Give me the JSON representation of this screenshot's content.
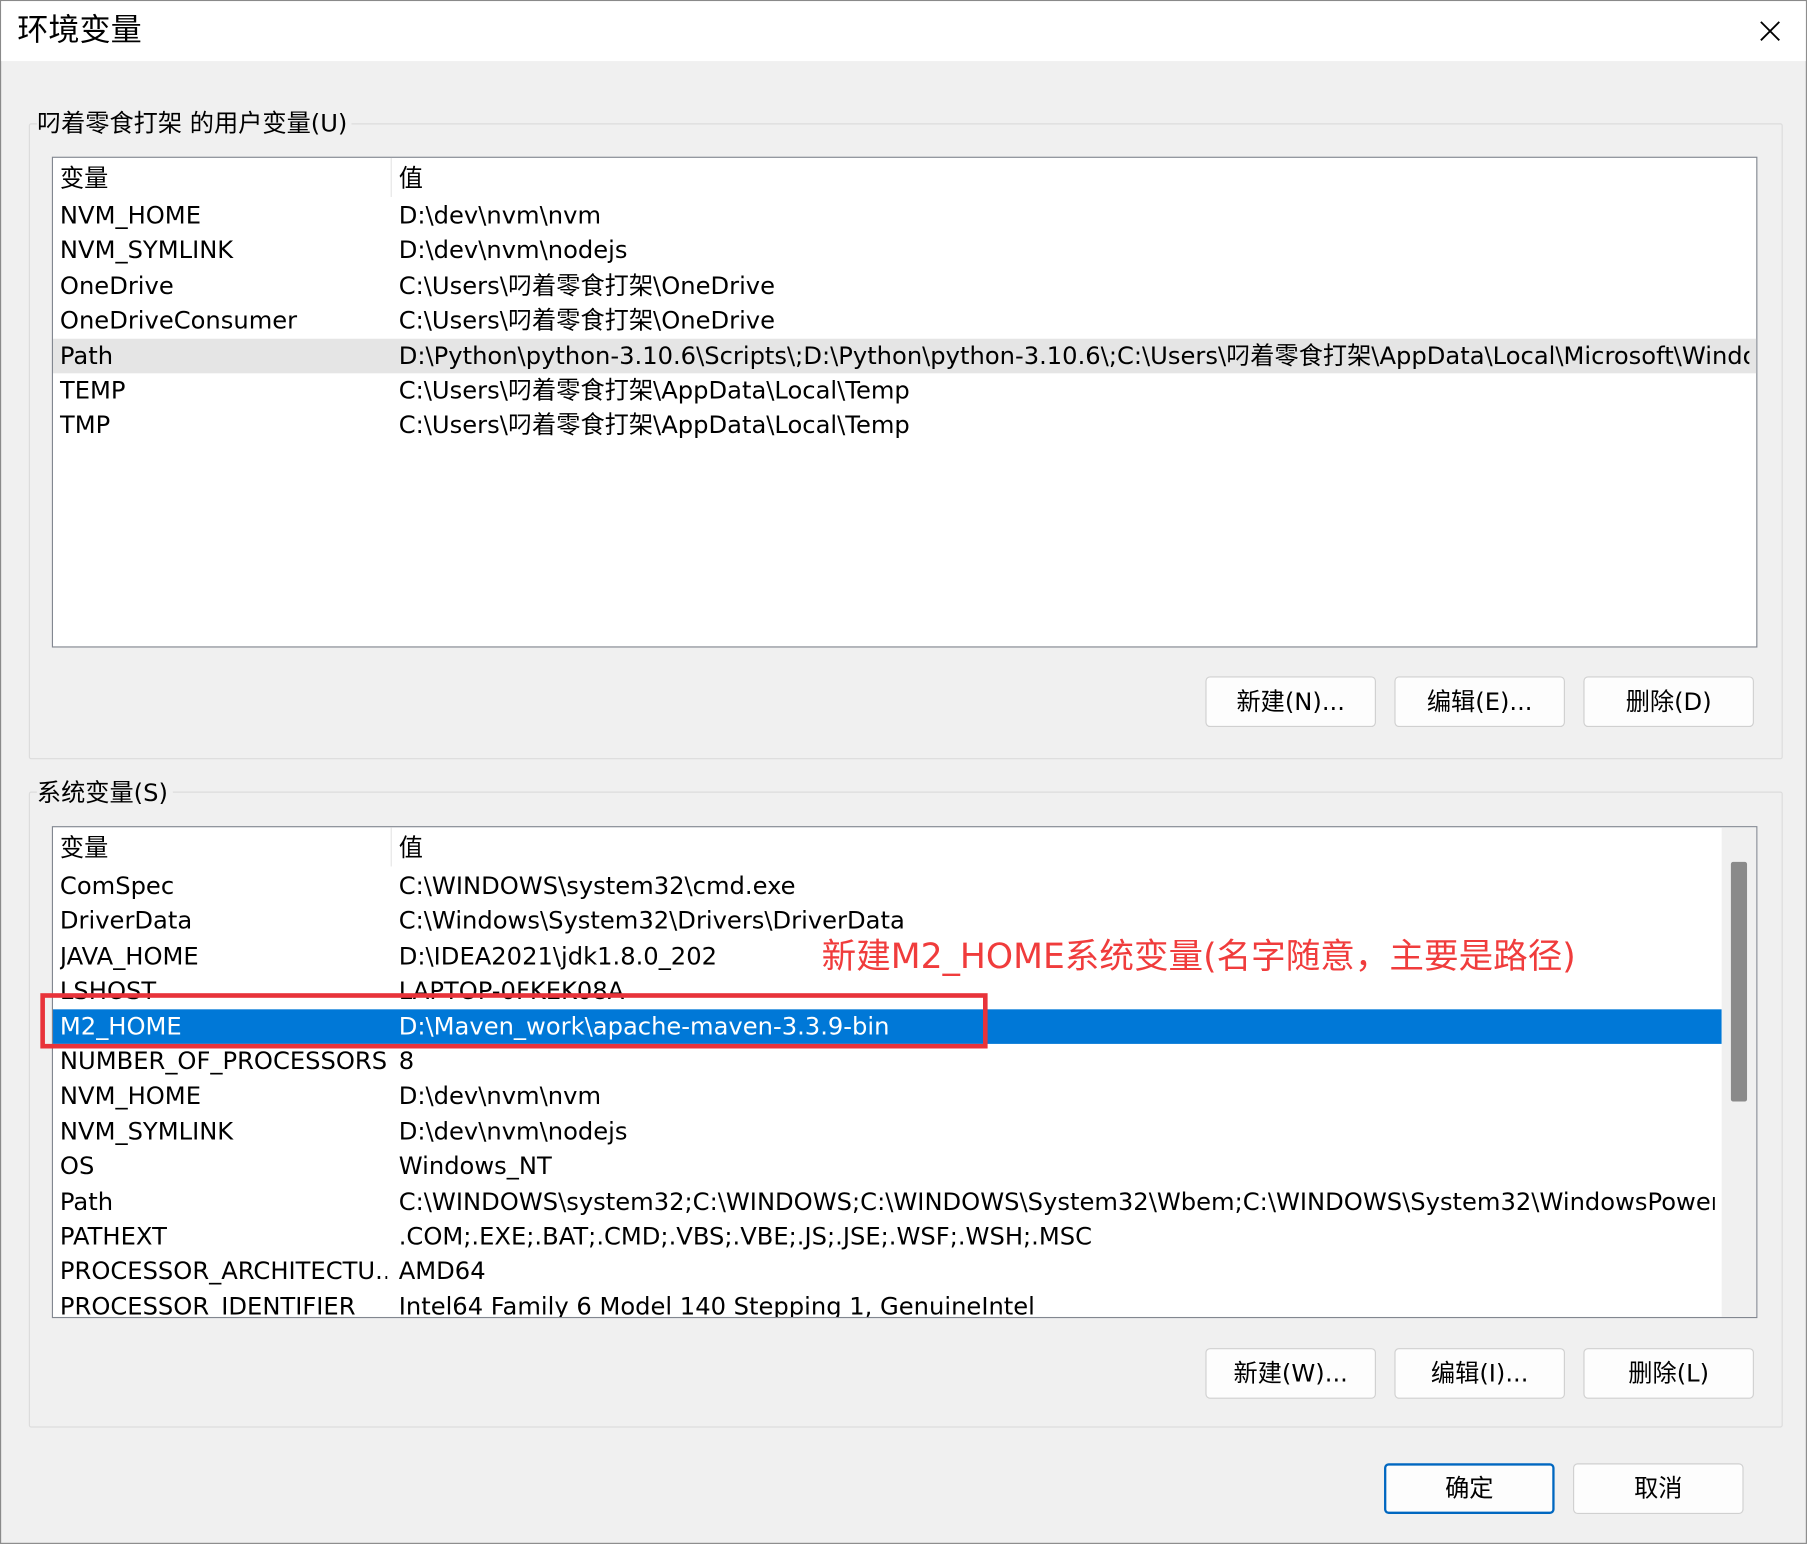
{
  "window": {
    "title": "环境变量",
    "close_icon": "close-icon"
  },
  "user_vars": {
    "group_label": "叼着零食打架 的用户变量(U)",
    "col_variable": "变量",
    "col_value": "值",
    "rows": [
      {
        "name": "NVM_HOME",
        "value": "D:\\dev\\nvm\\nvm"
      },
      {
        "name": "NVM_SYMLINK",
        "value": "D:\\dev\\nvm\\nodejs"
      },
      {
        "name": "OneDrive",
        "value": "C:\\Users\\叼着零食打架\\OneDrive"
      },
      {
        "name": "OneDriveConsumer",
        "value": "C:\\Users\\叼着零食打架\\OneDrive"
      },
      {
        "name": "Path",
        "value": "D:\\Python\\python-3.10.6\\Scripts\\;D:\\Python\\python-3.10.6\\;C:\\Users\\叼着零食打架\\AppData\\Local\\Microsoft\\Windo..."
      },
      {
        "name": "TEMP",
        "value": "C:\\Users\\叼着零食打架\\AppData\\Local\\Temp"
      },
      {
        "name": "TMP",
        "value": "C:\\Users\\叼着零食打架\\AppData\\Local\\Temp"
      }
    ],
    "buttons": {
      "new": "新建(N)...",
      "edit": "编辑(E)...",
      "delete": "删除(D)"
    }
  },
  "system_vars": {
    "group_label": "系统变量(S)",
    "col_variable": "变量",
    "col_value": "值",
    "rows": [
      {
        "name": "ComSpec",
        "value": "C:\\WINDOWS\\system32\\cmd.exe"
      },
      {
        "name": "DriverData",
        "value": "C:\\Windows\\System32\\Drivers\\DriverData"
      },
      {
        "name": "JAVA_HOME",
        "value": "D:\\IDEA2021\\jdk1.8.0_202"
      },
      {
        "name": "LSHOST",
        "value": "LAPTOP-0FKEK08A"
      },
      {
        "name": "M2_HOME",
        "value": "D:\\Maven_work\\apache-maven-3.3.9-bin"
      },
      {
        "name": "NUMBER_OF_PROCESSORS",
        "value": "8"
      },
      {
        "name": "NVM_HOME",
        "value": "D:\\dev\\nvm\\nvm"
      },
      {
        "name": "NVM_SYMLINK",
        "value": "D:\\dev\\nvm\\nodejs"
      },
      {
        "name": "OS",
        "value": "Windows_NT"
      },
      {
        "name": "Path",
        "value": "C:\\WINDOWS\\system32;C:\\WINDOWS;C:\\WINDOWS\\System32\\Wbem;C:\\WINDOWS\\System32\\WindowsPower..."
      },
      {
        "name": "PATHEXT",
        "value": ".COM;.EXE;.BAT;.CMD;.VBS;.VBE;.JS;.JSE;.WSF;.WSH;.MSC"
      },
      {
        "name": "PROCESSOR_ARCHITECTU...",
        "value": "AMD64"
      },
      {
        "name": "PROCESSOR_IDENTIFIER",
        "value": "Intel64 Family 6 Model 140 Stepping 1, GenuineIntel"
      }
    ],
    "selected": "M2_HOME",
    "buttons": {
      "new": "新建(W)...",
      "edit": "编辑(I)...",
      "delete": "删除(L)"
    }
  },
  "annotation": {
    "text": "新建M2_HOME系统变量(名字随意，主要是路径)",
    "color": "#f03c3c"
  },
  "footer": {
    "ok": "确定",
    "cancel": "取消"
  },
  "colors": {
    "selection": "#0078d7",
    "hover": "#e5e5e5",
    "dialog_bg": "#f0f0f0",
    "primary_border": "#0067c0"
  }
}
